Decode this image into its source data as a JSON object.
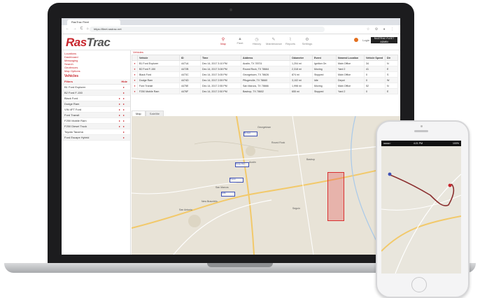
{
  "browser": {
    "tab_title": "RasTrac Fleet",
    "url": "https://fleet.rastrac.net",
    "nav_glyphs": "← → C ⌂",
    "ext_glyphs": "☆ ⚙ ● ⋮"
  },
  "app": {
    "logo_main": "Ras",
    "logo_tail": "Trac",
    "nav": [
      "Map",
      "Fleet",
      "History",
      "Maintenance",
      "Reports",
      "Settings"
    ],
    "user_label": "Login",
    "account_line1": "RASTRAC FLEET",
    "account_line2": "ADMIN"
  },
  "sidebar": {
    "menu": [
      "Locations",
      "Dashboard",
      "Messaging",
      "Search",
      "Geofences",
      "Map Options"
    ],
    "section_title": "Vehicles",
    "filter_label": "Filters",
    "filter_action": "Hide",
    "vehicles": [
      "B1 Ford Explorer",
      "B2 Ford F-150",
      "Black Ford",
      "Dodge Ram",
      "VIN 4FT Ford",
      "Ford Transit",
      "F250 Mobile Ram",
      "F250 Diesel Truck",
      "Toyota Tacoma",
      "Ford Escape Hybrid"
    ]
  },
  "main": {
    "breadcrumb": "Vehicles",
    "columns": [
      "",
      "Vehicle",
      "ID",
      "Time",
      "Address",
      "Odometer",
      "Event",
      "Nearest Location",
      "Vehicle Speed",
      "Dir"
    ],
    "rows": [
      [
        "●",
        "B1 Ford Explorer",
        "4471A",
        "Dec 14, 2017 3:10 PM",
        "Austin, TX 78701",
        "1,204 mi",
        "Ignition On",
        "Main Office",
        "34",
        "N"
      ],
      [
        "●",
        "B2 Ford F-150",
        "4472B",
        "Dec 14, 2017 3:08 PM",
        "Round Rock, TX 78664",
        "2,318 mi",
        "Moving",
        "Yard 2",
        "41",
        "E"
      ],
      [
        "●",
        "Black Ford",
        "4473C",
        "Dec 14, 2017 3:05 PM",
        "Georgetown, TX 78626",
        "874 mi",
        "Stopped",
        "Main Office",
        "0",
        "S"
      ],
      [
        "●",
        "Dodge Ram",
        "4474D",
        "Dec 14, 2017 2:59 PM",
        "Pflugerville, TX 78660",
        "3,102 mi",
        "Idle",
        "Depot",
        "0",
        "W"
      ],
      [
        "●",
        "Ford Transit",
        "4475E",
        "Dec 14, 2017 2:55 PM",
        "San Marcos, TX 78666",
        "1,998 mi",
        "Moving",
        "Main Office",
        "52",
        "N"
      ],
      [
        "●",
        "F250 Mobile Ram",
        "4476F",
        "Dec 14, 2017 2:50 PM",
        "Bastrop, TX 78602",
        "655 mi",
        "Stopped",
        "Yard 2",
        "0",
        "E"
      ]
    ],
    "map_tabs": [
      "Map",
      "Satellite"
    ],
    "map_labels": [
      "Austin",
      "San Antonio",
      "Georgetown",
      "Round Rock",
      "San Marcos",
      "New Braunfels",
      "Bastrop",
      "Seguin"
    ],
    "markers": [
      "B1 Ford",
      "Dodge Ram",
      "Transit",
      "F250"
    ]
  },
  "phone": {
    "carrier": "●●●●○ ",
    "time": "4:21 PM",
    "battery": "100%"
  },
  "colors": {
    "brand": "#c8252c",
    "geofence": "#d93030",
    "marker": "#3f51b5"
  }
}
